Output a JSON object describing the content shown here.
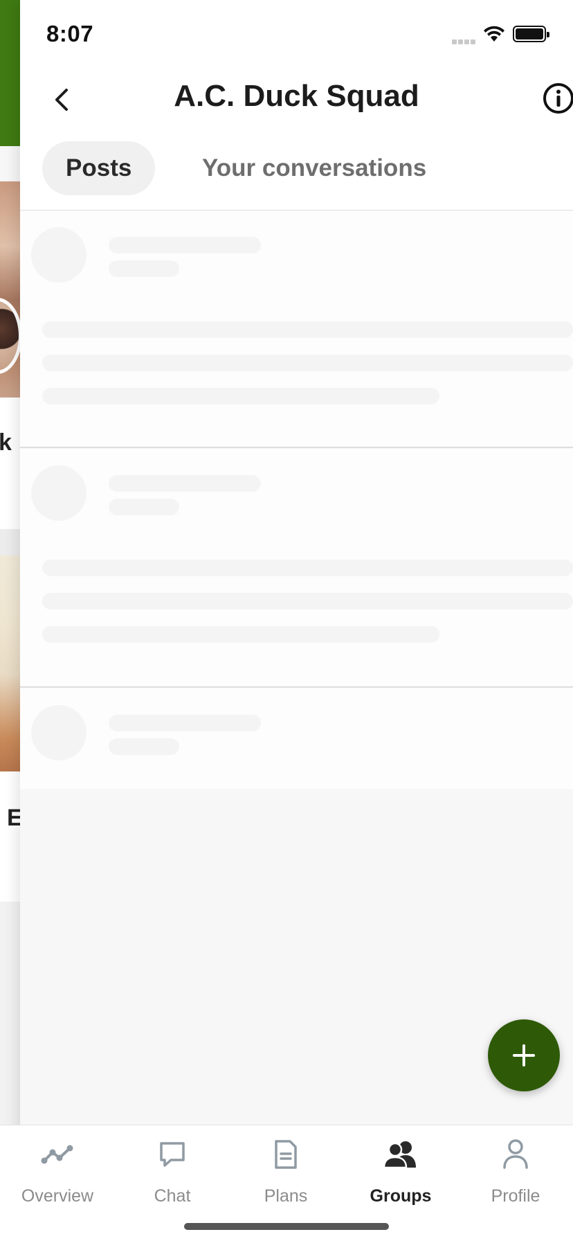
{
  "status_bar": {
    "time": "8:07"
  },
  "header": {
    "title": "A.C. Duck Squad"
  },
  "tabs": [
    {
      "label": "Posts",
      "selected": true
    },
    {
      "label": "Your conversations",
      "selected": false
    }
  ],
  "background_page": {
    "visible_fragments": [
      "k",
      "E"
    ]
  },
  "fab": {
    "icon": "plus-icon",
    "color": "#2e5a07"
  },
  "bottom_nav": {
    "items": [
      {
        "label": "Overview",
        "icon": "overview-icon",
        "active": false
      },
      {
        "label": "Chat",
        "icon": "chat-bubble-icon",
        "active": false
      },
      {
        "label": "Plans",
        "icon": "document-icon",
        "active": false
      },
      {
        "label": "Groups",
        "icon": "groups-icon",
        "active": true
      },
      {
        "label": "Profile",
        "icon": "person-icon",
        "active": false
      }
    ]
  },
  "colors": {
    "brand_green": "#2e5a07",
    "header_green": "#3f7a12"
  }
}
